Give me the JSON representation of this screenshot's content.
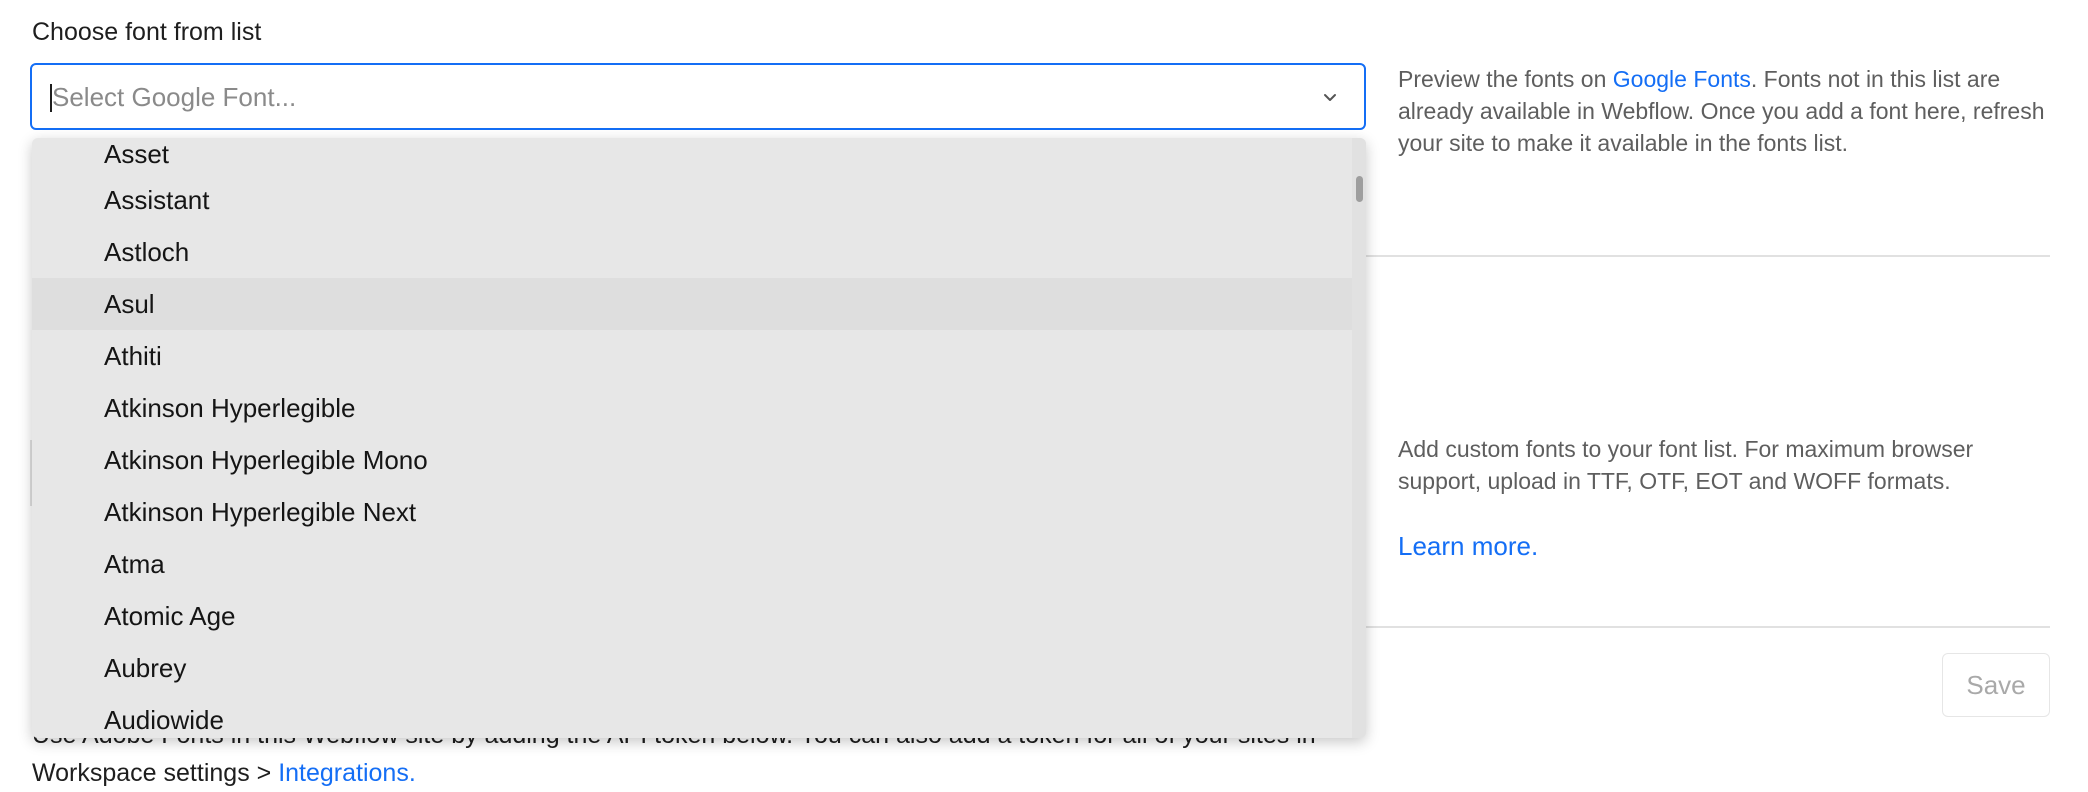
{
  "font_picker": {
    "label": "Choose font from list",
    "placeholder": "Select Google Font...",
    "value": ""
  },
  "dropdown": {
    "options": [
      "Asset",
      "Assistant",
      "Astloch",
      "Asul",
      "Athiti",
      "Atkinson Hyperlegible",
      "Atkinson Hyperlegible Mono",
      "Atkinson Hyperlegible Next",
      "Atma",
      "Atomic Age",
      "Aubrey",
      "Audiowide"
    ],
    "hovered_option": "Asul"
  },
  "google_fonts_help": {
    "text_before": "Preview the fonts on ",
    "link": "Google Fonts",
    "text_after": ". Fonts not in this list are already available in Webflow. Once you add a font here, refresh your site to make it available in the fonts list."
  },
  "custom_fonts_help": {
    "text": "Add custom fonts to your font list. For maximum browser support, upload in TTF, OTF, EOT and WOFF formats.",
    "learn_more": "Learn more."
  },
  "adobe_fonts": {
    "text_before": "Use Adobe Fonts in this Webflow site by adding the API token below. You can also add a token for all of your sites in Workspace settings > ",
    "link": "Integrations."
  },
  "save_button": {
    "label": "Save"
  },
  "colors": {
    "accent": "#146ef5",
    "dropdown_bg": "#e7e7e7",
    "hover_bg": "#dedede",
    "muted_text": "#5e5e5e"
  },
  "icons": {
    "select": "chevron-down-icon"
  }
}
